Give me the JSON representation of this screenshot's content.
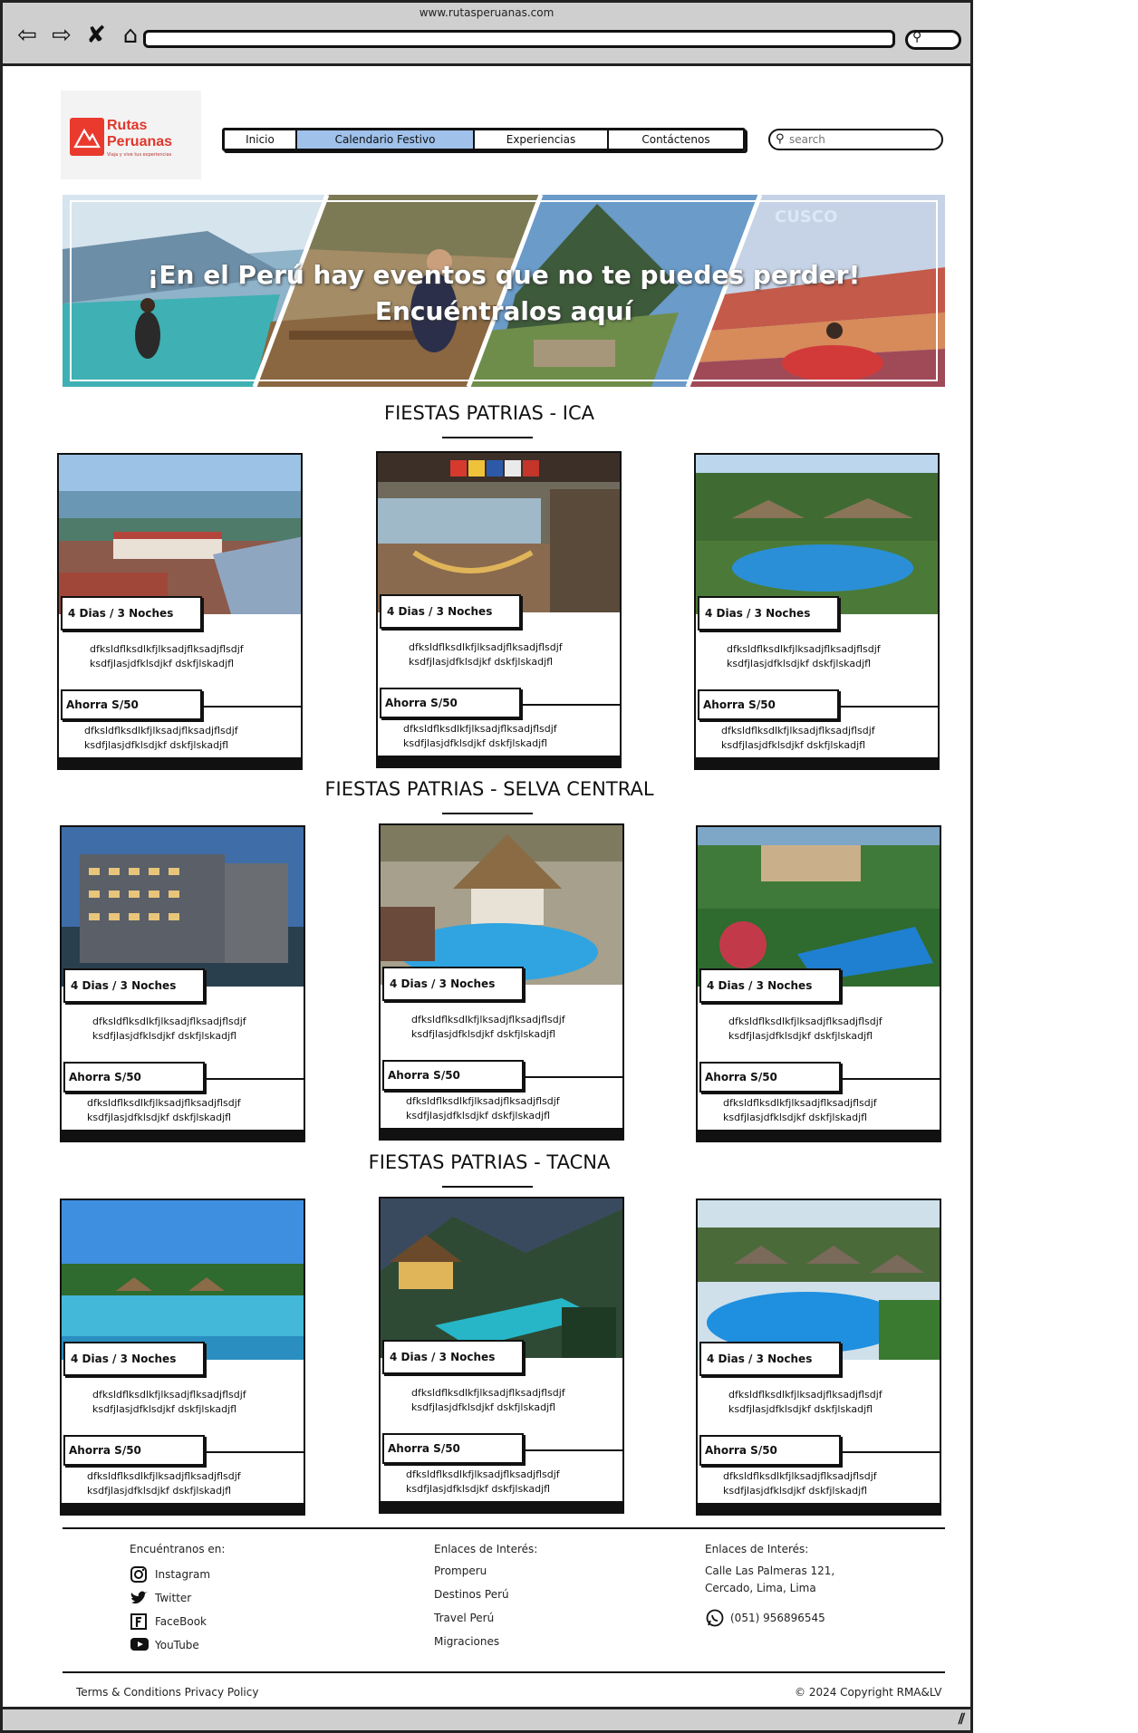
{
  "browser": {
    "url": "www.rutasperuanas.com",
    "nav_icons": [
      "back-arrow-icon",
      "forward-arrow-icon",
      "close-icon",
      "home-icon"
    ]
  },
  "header": {
    "logo": {
      "line1": "Rutas",
      "line2": "Peruanas",
      "tagline": "Viaja y vive tus experiencias"
    },
    "menu": [
      {
        "label": "Inicio",
        "active": false
      },
      {
        "label": "Calendario Festivo",
        "active": true
      },
      {
        "label": "Experiencias",
        "active": false
      },
      {
        "label": "Contáctenos",
        "active": false
      }
    ],
    "search_placeholder": "search"
  },
  "hero": {
    "line1": "¡En el Perú hay eventos que no te puedes perder!",
    "line2": "Encuéntralos aquí",
    "watermark": "CUSCO"
  },
  "sections": [
    {
      "title": "FIESTAS PATRIAS - ICA",
      "cards": [
        {
          "duration": "4 Dias / 3 Noches",
          "desc": [
            "dfksldflksdlkfjlksadjflksadjflsdjf",
            "ksdfjlasjdfklsdjkf dskfjlskadjfl"
          ],
          "price": "Ahorra S/50",
          "note": [
            "dfksldflksdlkfjlksadjflksadjflsdjf",
            "ksdfjlasjdfklsdjkf dskfjlskadjfl"
          ],
          "photo": "lake-town"
        },
        {
          "duration": "4 Dias / 3 Noches",
          "desc": [
            "dfksldflksdlkfjlksadjflksadjflsdjf",
            "ksdfjlasjdfklsdjkf dskfjlskadjfl"
          ],
          "price": "Ahorra S/50",
          "note": [
            "dfksldflksdlkfjlksadjflksadjflsdjf",
            "ksdfjlasjdfklsdjkf dskfjlskadjfl"
          ],
          "photo": "hostel-terrace"
        },
        {
          "duration": "4 Dias / 3 Noches",
          "desc": [
            "dfksldflksdlkfjlksadjflksadjflsdjf",
            "ksdfjlasjdfklsdjkf dskfjlskadjfl"
          ],
          "price": "Ahorra S/50",
          "note": [
            "dfksldflksdlkfjlksadjflksadjflsdjf",
            "ksdfjlasjdfklsdjkf dskfjlskadjfl"
          ],
          "photo": "jungle-pool"
        }
      ]
    },
    {
      "title": "FIESTAS PATRIAS - SELVA CENTRAL",
      "cards": [
        {
          "duration": "4 Dias / 3 Noches",
          "desc": [
            "dfksldflksdlkfjlksadjflksadjflsdjf",
            "ksdfjlasjdfklsdjkf dskfjlskadjfl"
          ],
          "price": "Ahorra S/50",
          "note": [
            "dfksldflksdlkfjlksadjflksadjflsdjf",
            "ksdfjlasjdfklsdjkf dskfjlskadjfl"
          ],
          "photo": "hotel-building"
        },
        {
          "duration": "4 Dias / 3 Noches",
          "desc": [
            "dfksldflksdlkfjlksadjflksadjflsdjf",
            "ksdfjlasjdfklsdjkf dskfjlskadjfl"
          ],
          "price": "Ahorra S/50",
          "note": [
            "dfksldflksdlkfjlksadjflksadjflsdjf",
            "ksdfjlasjdfklsdjkf dskfjlskadjfl"
          ],
          "photo": "thatched-pool"
        },
        {
          "duration": "4 Dias / 3 Noches",
          "desc": [
            "dfksldflksdlkfjlksadjflksadjflsdjf",
            "ksdfjlasjdfklsdjkf dskfjlskadjfl"
          ],
          "price": "Ahorra S/50",
          "note": [
            "dfksldflksdlkfjlksadjflksadjflsdjf",
            "ksdfjlasjdfklsdjkf dskfjlskadjfl"
          ],
          "photo": "garden-pool"
        }
      ]
    },
    {
      "title": "FIESTAS PATRIAS - TACNA",
      "cards": [
        {
          "duration": "4 Dias / 3 Noches",
          "desc": [
            "dfksldflksdlkfjlksadjflksadjflsdjf",
            "ksdfjlasjdfklsdjkf dskfjlskadjfl"
          ],
          "price": "Ahorra S/50",
          "note": [
            "dfksldflksdlkfjlksadjflksadjflsdjf",
            "ksdfjlasjdfklsdjkf dskfjlskadjfl"
          ],
          "photo": "lagoon-pool"
        },
        {
          "duration": "4 Dias / 3 Noches",
          "desc": [
            "dfksldflksdlkfjlksadjflksadjflsdjf",
            "ksdfjlasjdfklsdjkf dskfjlskadjfl"
          ],
          "price": "Ahorra S/50",
          "note": [
            "dfksldflksdlkfjlksadjflksadjflsdjf",
            "ksdfjlasjdfklsdjkf dskfjlskadjfl"
          ],
          "photo": "night-lodge"
        },
        {
          "duration": "4 Dias / 3 Noches",
          "desc": [
            "dfksldflksdlkfjlksadjflksadjflsdjf",
            "ksdfjlasjdfklsdjkf dskfjlskadjfl"
          ],
          "price": "Ahorra S/50",
          "note": [
            "dfksldflksdlkfjlksadjflksadjflsdjf",
            "ksdfjlasjdfklsdjkf dskfjlskadjfl"
          ],
          "photo": "umbrella-pool"
        }
      ]
    }
  ],
  "footer": {
    "social": {
      "heading": "Encuéntranos en:",
      "items": [
        {
          "label": "Instagram",
          "icon": "instagram-icon"
        },
        {
          "label": "Twitter",
          "icon": "twitter-icon"
        },
        {
          "label": "FaceBook",
          "icon": "facebook-icon"
        },
        {
          "label": "YouTube",
          "icon": "youtube-icon"
        }
      ]
    },
    "links": {
      "heading": "Enlaces de Interés:",
      "items": [
        "Promperu",
        "Destinos Perú",
        "Travel Perú",
        "Migraciones"
      ]
    },
    "contact": {
      "heading": "Enlaces de Interés:",
      "address": [
        "Calle Las Palmeras 121,",
        "Cercado, Lima, Lima"
      ],
      "phone": "(051) 956896545",
      "phone_icon": "whatsapp-icon"
    },
    "legal": "Terms & Conditions Privacy Policy",
    "copyright": "© 2024 Copyright RMA&LV"
  },
  "colors": {
    "active_menu": "#9fc1ea",
    "brand_red": "#e0372b"
  }
}
